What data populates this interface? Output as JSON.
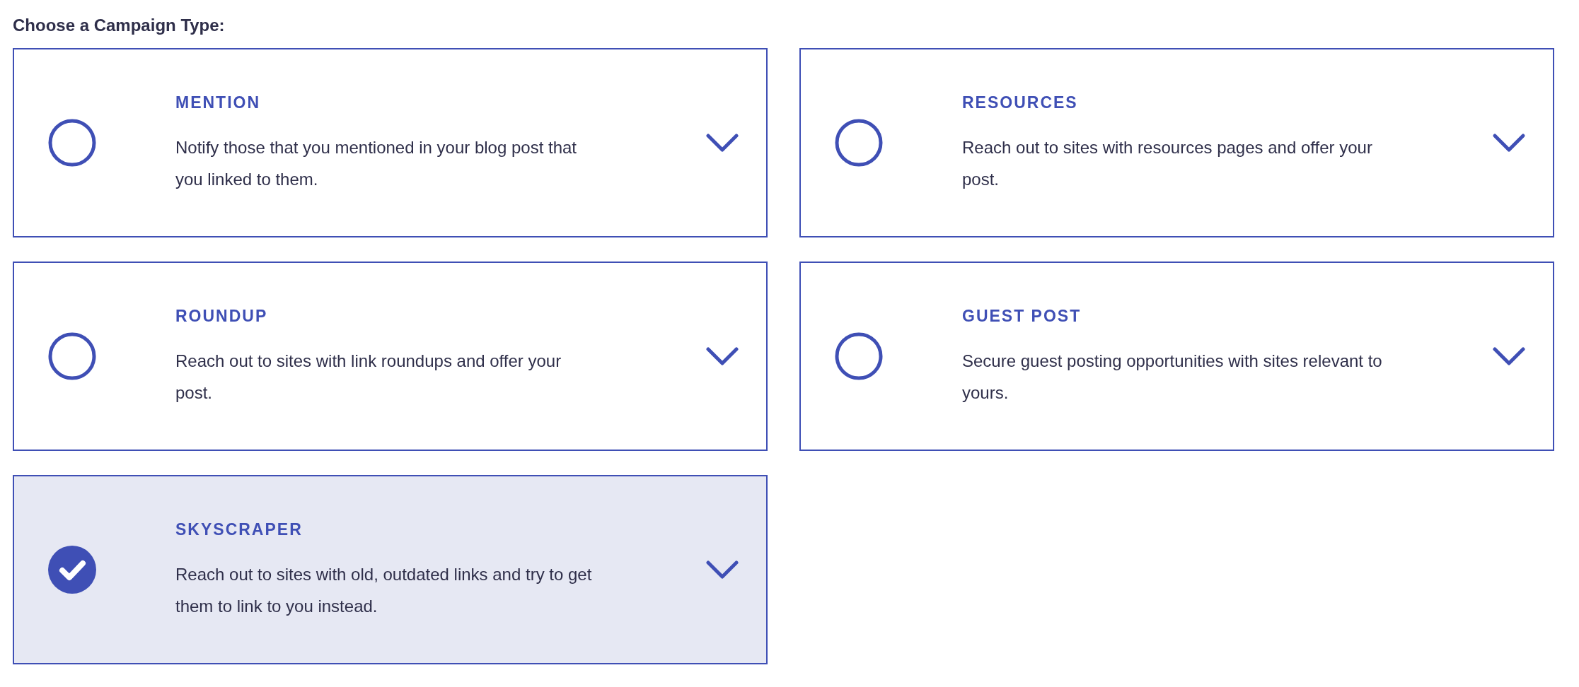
{
  "heading": "Choose a Campaign Type:",
  "campaign_types": [
    {
      "title": "MENTION",
      "description": "Notify those that you mentioned in your blog post that you linked to them.",
      "selected": false
    },
    {
      "title": "RESOURCES",
      "description": "Reach out to sites with resources pages and offer your post.",
      "selected": false
    },
    {
      "title": "ROUNDUP",
      "description": "Reach out to sites with link roundups and offer your post.",
      "selected": false
    },
    {
      "title": "GUEST POST",
      "description": "Secure guest posting opportunities with sites relevant to yours.",
      "selected": false
    },
    {
      "title": "SKYSCRAPER",
      "description": "Reach out to sites with old, outdated links and try to get them to link to you instead.",
      "selected": true
    }
  ]
}
